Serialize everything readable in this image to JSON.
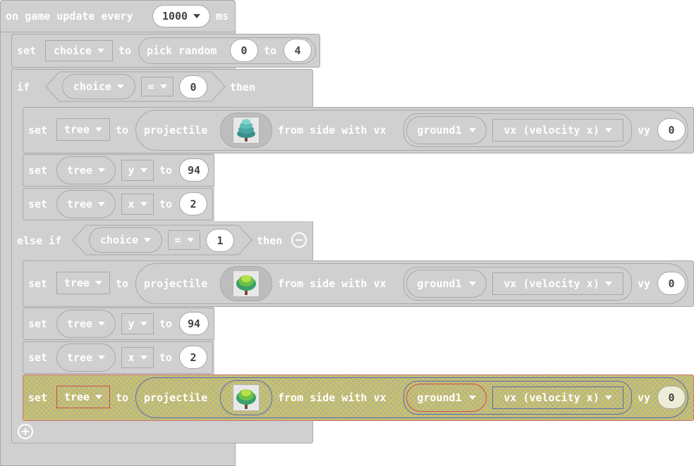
{
  "event": {
    "prefix": "on game update every",
    "interval": "1000",
    "suffix": "ms"
  },
  "kw": {
    "set": "set",
    "to": "to",
    "if": "if",
    "else_if": "else if",
    "then": "then",
    "pick_random": "pick random",
    "projectile": "projectile",
    "from_side": "from side with vx",
    "vy": "vy"
  },
  "set_choice": {
    "var": "choice",
    "min": "0",
    "max": "4"
  },
  "if1": {
    "var": "choice",
    "op": "=",
    "value": "0"
  },
  "branch1": {
    "projectile": {
      "var": "tree",
      "sprite": "tree-pine-sprite",
      "vx_obj": "ground1",
      "vx_prop": "vx (velocity x)",
      "vy": "0"
    },
    "set_y": {
      "var": "tree",
      "prop": "y",
      "value": "94"
    },
    "set_x": {
      "var": "tree",
      "prop": "x",
      "value": "2"
    }
  },
  "if2": {
    "var": "choice",
    "op": "=",
    "value": "1"
  },
  "branch2": {
    "projectile": {
      "var": "tree",
      "sprite": "tree-round-sprite",
      "vx_obj": "ground1",
      "vx_prop": "vx (velocity x)",
      "vy": "0"
    },
    "set_y": {
      "var": "tree",
      "prop": "y",
      "value": "94"
    },
    "set_x": {
      "var": "tree",
      "prop": "x",
      "value": "2"
    },
    "projectile_dragging": {
      "var": "tree",
      "sprite": "tree-round-sprite",
      "vx_obj": "ground1",
      "vx_prop": "vx (velocity x)",
      "vy": "0"
    }
  },
  "colors": {
    "block": "#d0d0d0",
    "border": "#a8a8a8",
    "text": "#ffffff",
    "number_text": "#444444",
    "highlight": "#c9c46a"
  }
}
